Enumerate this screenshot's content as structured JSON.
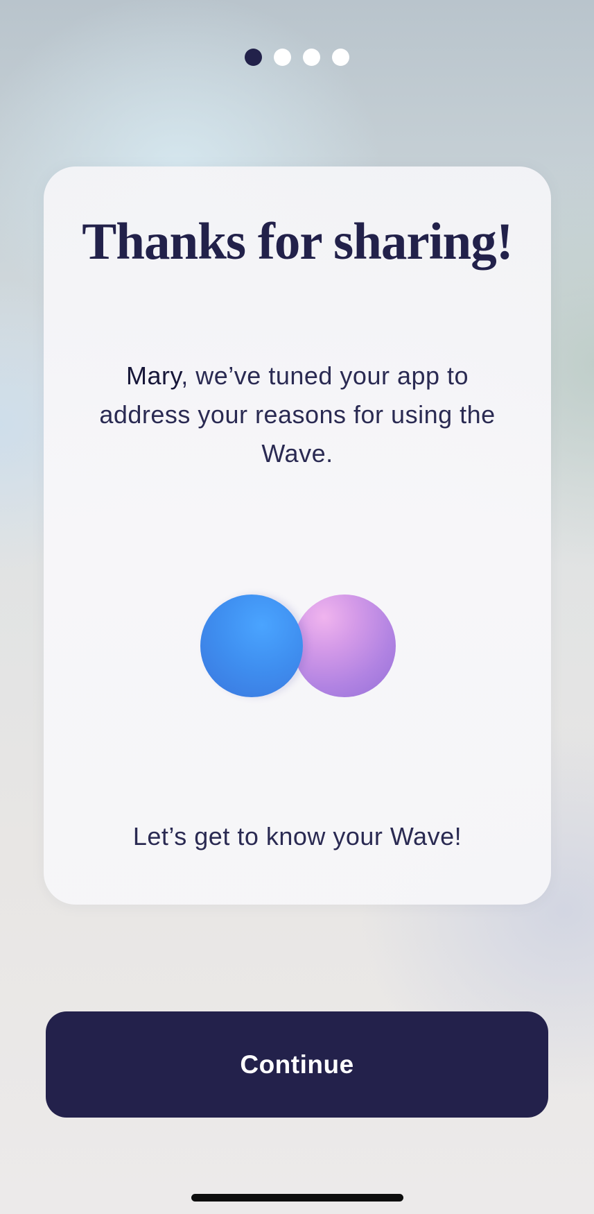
{
  "pagination": {
    "total": 4,
    "active_index": 0
  },
  "card": {
    "title": "Thanks for sharing!",
    "user_name": "Mary",
    "message": ", we’ve tuned your app to address your reasons for using the Wave.",
    "cta": "Let’s get to know your Wave!"
  },
  "continue_button": {
    "label": "Continue"
  },
  "colors": {
    "primary": "#22214a",
    "orb_blue": "#3f8ff0",
    "orb_purple": "#b183e2"
  }
}
